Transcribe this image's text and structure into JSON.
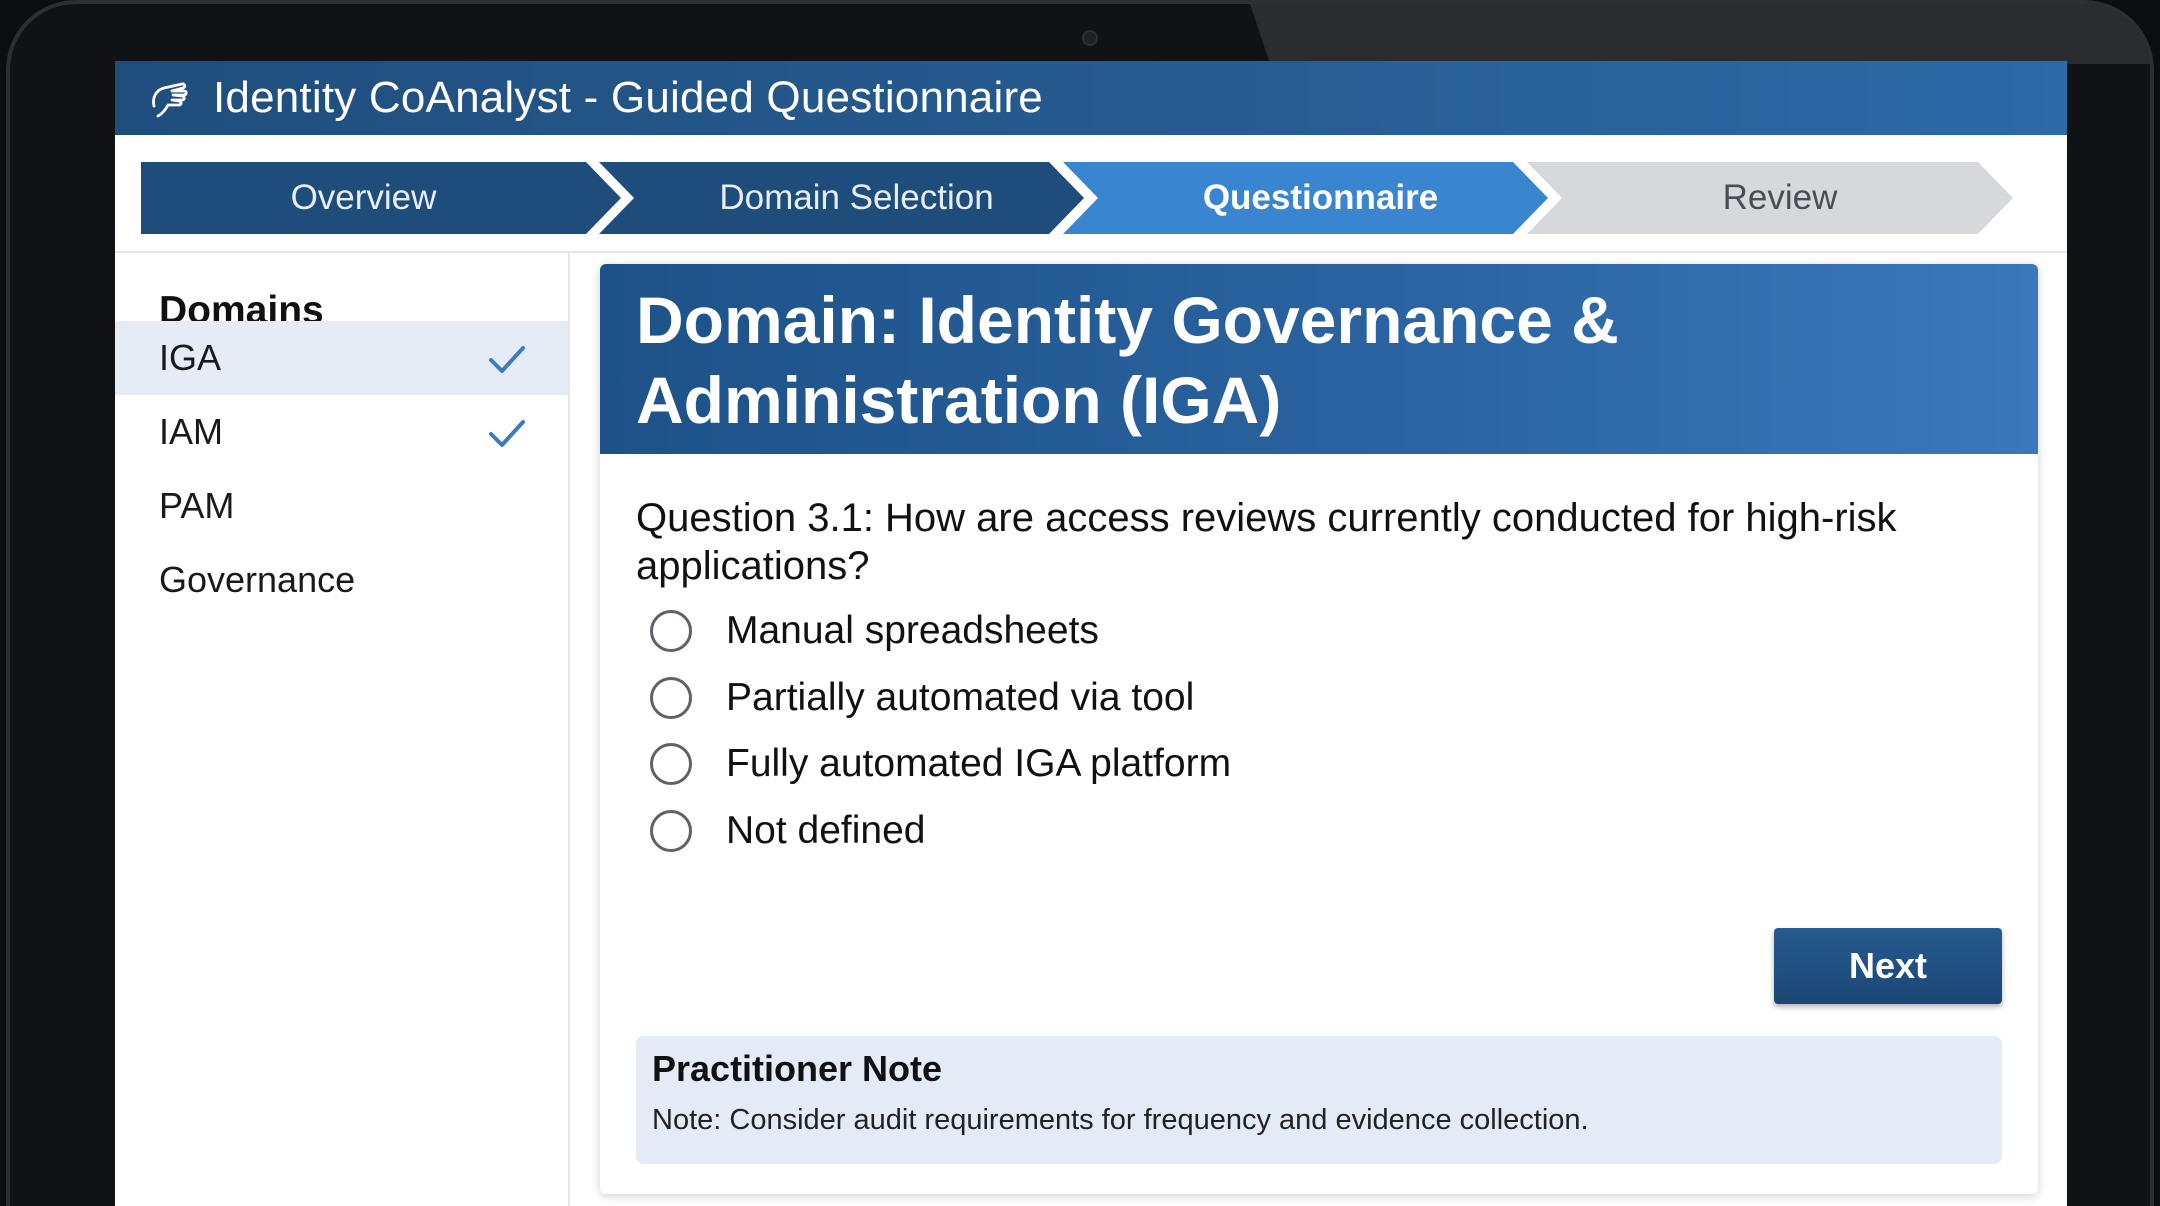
{
  "app": {
    "title": "Identity CoAnalyst - Guided Questionnaire",
    "icon": "hand-pointer-icon"
  },
  "stepper": {
    "steps": [
      {
        "label": "Overview",
        "state": "done"
      },
      {
        "label": "Domain Selection",
        "state": "done"
      },
      {
        "label": "Questionnaire",
        "state": "current"
      },
      {
        "label": "Review",
        "state": "pending"
      }
    ]
  },
  "sidebar": {
    "heading": "Domains",
    "items": [
      {
        "label": "IGA",
        "completed": true,
        "active": true
      },
      {
        "label": "IAM",
        "completed": true,
        "active": false
      },
      {
        "label": "PAM",
        "completed": false,
        "active": false
      },
      {
        "label": "Governance",
        "completed": false,
        "active": false
      }
    ]
  },
  "main": {
    "domain_title_line1": "Domain: Identity Governance &",
    "domain_title_line2": "Administration (IGA)",
    "question": "Question 3.1: How are access reviews currently conducted for high-risk applications?",
    "options": [
      {
        "label": "Manual spreadsheets",
        "selected": false
      },
      {
        "label": "Partially automated via tool",
        "selected": false
      },
      {
        "label": "Fully automated IGA platform",
        "selected": false
      },
      {
        "label": "Not defined",
        "selected": false
      }
    ],
    "next_label": "Next",
    "note": {
      "title": "Practitioner Note",
      "text": "Note: Consider audit requirements for frequency and evidence collection."
    }
  },
  "colors": {
    "primary_dark": "#1e4d7b",
    "primary_active": "#3a85cf",
    "check": "#3a7cc4",
    "note_bg": "#e3ebf6"
  }
}
